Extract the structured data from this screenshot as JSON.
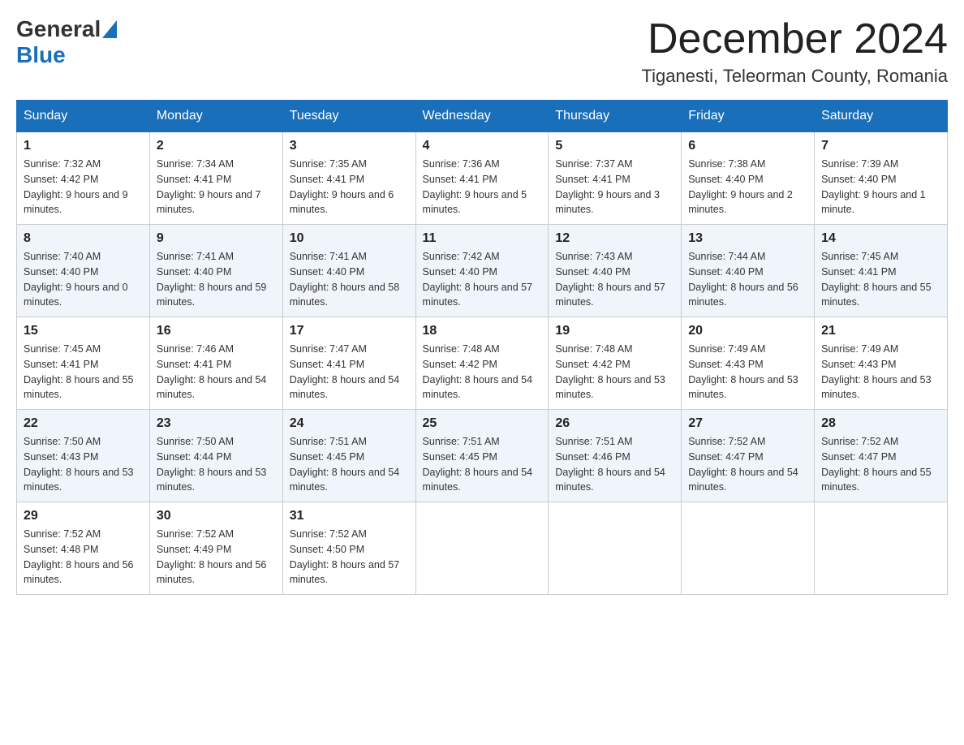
{
  "header": {
    "month_title": "December 2024",
    "location": "Tiganesti, Teleorman County, Romania",
    "logo_general": "General",
    "logo_blue": "Blue"
  },
  "weekdays": [
    "Sunday",
    "Monday",
    "Tuesday",
    "Wednesday",
    "Thursday",
    "Friday",
    "Saturday"
  ],
  "weeks": [
    [
      {
        "day": "1",
        "sunrise": "7:32 AM",
        "sunset": "4:42 PM",
        "daylight": "9 hours and 9 minutes."
      },
      {
        "day": "2",
        "sunrise": "7:34 AM",
        "sunset": "4:41 PM",
        "daylight": "9 hours and 7 minutes."
      },
      {
        "day": "3",
        "sunrise": "7:35 AM",
        "sunset": "4:41 PM",
        "daylight": "9 hours and 6 minutes."
      },
      {
        "day": "4",
        "sunrise": "7:36 AM",
        "sunset": "4:41 PM",
        "daylight": "9 hours and 5 minutes."
      },
      {
        "day": "5",
        "sunrise": "7:37 AM",
        "sunset": "4:41 PM",
        "daylight": "9 hours and 3 minutes."
      },
      {
        "day": "6",
        "sunrise": "7:38 AM",
        "sunset": "4:40 PM",
        "daylight": "9 hours and 2 minutes."
      },
      {
        "day": "7",
        "sunrise": "7:39 AM",
        "sunset": "4:40 PM",
        "daylight": "9 hours and 1 minute."
      }
    ],
    [
      {
        "day": "8",
        "sunrise": "7:40 AM",
        "sunset": "4:40 PM",
        "daylight": "9 hours and 0 minutes."
      },
      {
        "day": "9",
        "sunrise": "7:41 AM",
        "sunset": "4:40 PM",
        "daylight": "8 hours and 59 minutes."
      },
      {
        "day": "10",
        "sunrise": "7:41 AM",
        "sunset": "4:40 PM",
        "daylight": "8 hours and 58 minutes."
      },
      {
        "day": "11",
        "sunrise": "7:42 AM",
        "sunset": "4:40 PM",
        "daylight": "8 hours and 57 minutes."
      },
      {
        "day": "12",
        "sunrise": "7:43 AM",
        "sunset": "4:40 PM",
        "daylight": "8 hours and 57 minutes."
      },
      {
        "day": "13",
        "sunrise": "7:44 AM",
        "sunset": "4:40 PM",
        "daylight": "8 hours and 56 minutes."
      },
      {
        "day": "14",
        "sunrise": "7:45 AM",
        "sunset": "4:41 PM",
        "daylight": "8 hours and 55 minutes."
      }
    ],
    [
      {
        "day": "15",
        "sunrise": "7:45 AM",
        "sunset": "4:41 PM",
        "daylight": "8 hours and 55 minutes."
      },
      {
        "day": "16",
        "sunrise": "7:46 AM",
        "sunset": "4:41 PM",
        "daylight": "8 hours and 54 minutes."
      },
      {
        "day": "17",
        "sunrise": "7:47 AM",
        "sunset": "4:41 PM",
        "daylight": "8 hours and 54 minutes."
      },
      {
        "day": "18",
        "sunrise": "7:48 AM",
        "sunset": "4:42 PM",
        "daylight": "8 hours and 54 minutes."
      },
      {
        "day": "19",
        "sunrise": "7:48 AM",
        "sunset": "4:42 PM",
        "daylight": "8 hours and 53 minutes."
      },
      {
        "day": "20",
        "sunrise": "7:49 AM",
        "sunset": "4:43 PM",
        "daylight": "8 hours and 53 minutes."
      },
      {
        "day": "21",
        "sunrise": "7:49 AM",
        "sunset": "4:43 PM",
        "daylight": "8 hours and 53 minutes."
      }
    ],
    [
      {
        "day": "22",
        "sunrise": "7:50 AM",
        "sunset": "4:43 PM",
        "daylight": "8 hours and 53 minutes."
      },
      {
        "day": "23",
        "sunrise": "7:50 AM",
        "sunset": "4:44 PM",
        "daylight": "8 hours and 53 minutes."
      },
      {
        "day": "24",
        "sunrise": "7:51 AM",
        "sunset": "4:45 PM",
        "daylight": "8 hours and 54 minutes."
      },
      {
        "day": "25",
        "sunrise": "7:51 AM",
        "sunset": "4:45 PM",
        "daylight": "8 hours and 54 minutes."
      },
      {
        "day": "26",
        "sunrise": "7:51 AM",
        "sunset": "4:46 PM",
        "daylight": "8 hours and 54 minutes."
      },
      {
        "day": "27",
        "sunrise": "7:52 AM",
        "sunset": "4:47 PM",
        "daylight": "8 hours and 54 minutes."
      },
      {
        "day": "28",
        "sunrise": "7:52 AM",
        "sunset": "4:47 PM",
        "daylight": "8 hours and 55 minutes."
      }
    ],
    [
      {
        "day": "29",
        "sunrise": "7:52 AM",
        "sunset": "4:48 PM",
        "daylight": "8 hours and 56 minutes."
      },
      {
        "day": "30",
        "sunrise": "7:52 AM",
        "sunset": "4:49 PM",
        "daylight": "8 hours and 56 minutes."
      },
      {
        "day": "31",
        "sunrise": "7:52 AM",
        "sunset": "4:50 PM",
        "daylight": "8 hours and 57 minutes."
      },
      null,
      null,
      null,
      null
    ]
  ]
}
